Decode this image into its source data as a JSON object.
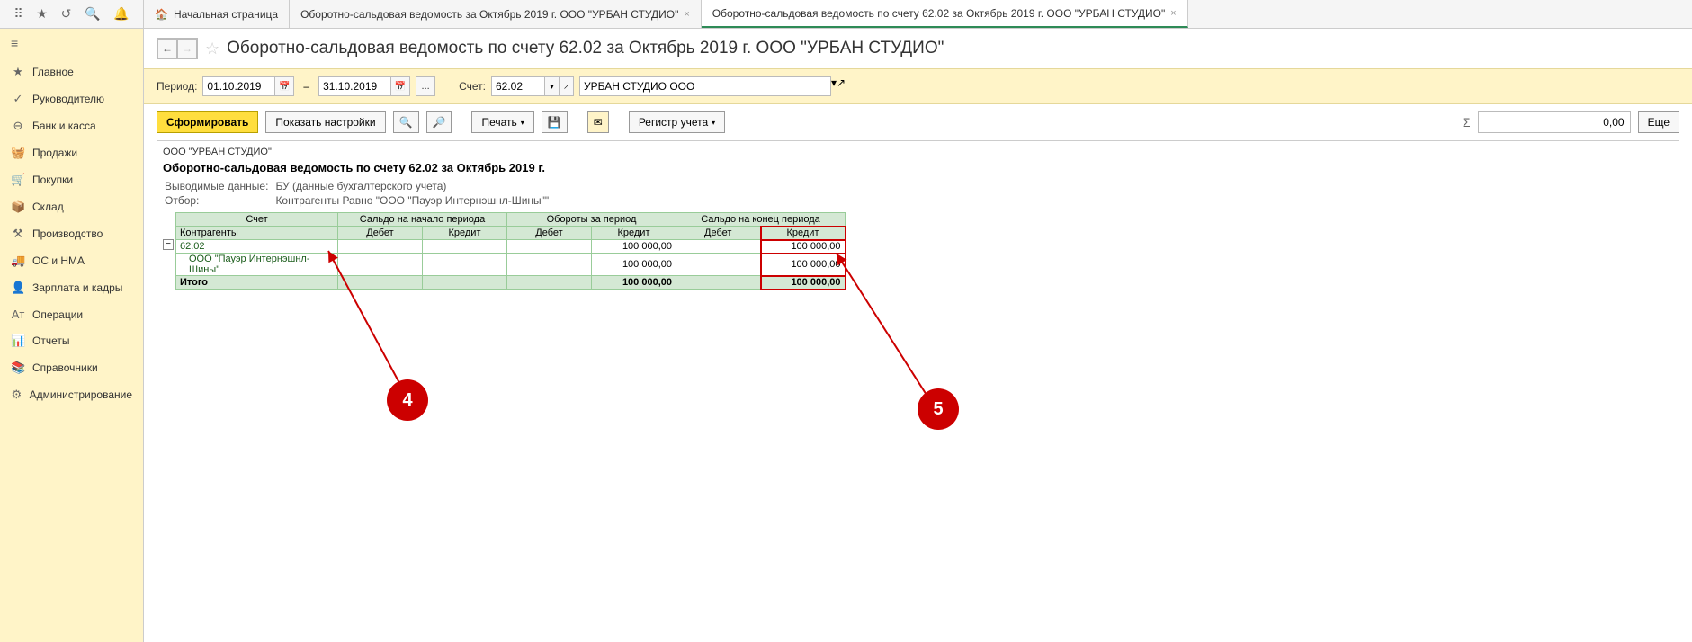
{
  "topbar": {
    "tabs": [
      {
        "label": "Начальная страница",
        "home": true
      },
      {
        "label": "Оборотно-сальдовая ведомость за Октябрь 2019 г. ООО \"УРБАН СТУДИО\"",
        "closable": true
      },
      {
        "label": "Оборотно-сальдовая ведомость по счету 62.02 за Октябрь 2019 г. ООО \"УРБАН СТУДИО\"",
        "closable": true,
        "active": true
      }
    ]
  },
  "sidebar": {
    "items": [
      {
        "icon": "★",
        "label": "Главное"
      },
      {
        "icon": "✓",
        "label": "Руководителю"
      },
      {
        "icon": "⊖",
        "label": "Банк и касса"
      },
      {
        "icon": "🧺",
        "label": "Продажи"
      },
      {
        "icon": "🛒",
        "label": "Покупки"
      },
      {
        "icon": "📦",
        "label": "Склад"
      },
      {
        "icon": "⚒",
        "label": "Производство"
      },
      {
        "icon": "🚚",
        "label": "ОС и НМА"
      },
      {
        "icon": "👤",
        "label": "Зарплата и кадры"
      },
      {
        "icon": "Aᴛ",
        "label": "Операции"
      },
      {
        "icon": "📊",
        "label": "Отчеты"
      },
      {
        "icon": "📚",
        "label": "Справочники"
      },
      {
        "icon": "⚙",
        "label": "Администрирование"
      }
    ]
  },
  "title": "Оборотно-сальдовая ведомость по счету 62.02 за Октябрь 2019 г. ООО \"УРБАН СТУДИО\"",
  "filter": {
    "period_label": "Период:",
    "date_from": "01.10.2019",
    "date_to": "31.10.2019",
    "account_label": "Счет:",
    "account": "62.02",
    "org": "УРБАН СТУДИО ООО"
  },
  "toolbar": {
    "generate": "Сформировать",
    "show_settings": "Показать настройки",
    "print": "Печать",
    "register": "Регистр учета",
    "sigma": "Σ",
    "sum": "0,00",
    "more": "Еще"
  },
  "report": {
    "company": "ООО \"УРБАН СТУДИО\"",
    "title": "Оборотно-сальдовая ведомость по счету 62.02 за Октябрь 2019 г.",
    "meta_data_label": "Выводимые данные:",
    "meta_data_value": "БУ (данные бухгалтерского учета)",
    "meta_filter_label": "Отбор:",
    "meta_filter_value": "Контрагенты Равно \"ООО \"Пауэр Интернэшнл-Шины\"\"",
    "head": {
      "account": "Счет",
      "contragents": "Контрагенты",
      "start": "Сальдо на начало периода",
      "turn": "Обороты за период",
      "end": "Сальдо на конец периода",
      "debit": "Дебет",
      "credit": "Кредит"
    },
    "rows": [
      {
        "label": "62.02",
        "turn_credit": "100 000,00",
        "end_credit": "100 000,00"
      },
      {
        "label": "ООО \"Пауэр Интернэшнл-Шины\"",
        "turn_credit": "100 000,00",
        "end_credit": "100 000,00",
        "indent": true
      }
    ],
    "total": {
      "label": "Итого",
      "turn_credit": "100 000,00",
      "end_credit": "100 000,00"
    }
  },
  "annotations": {
    "a": "4",
    "b": "5"
  }
}
